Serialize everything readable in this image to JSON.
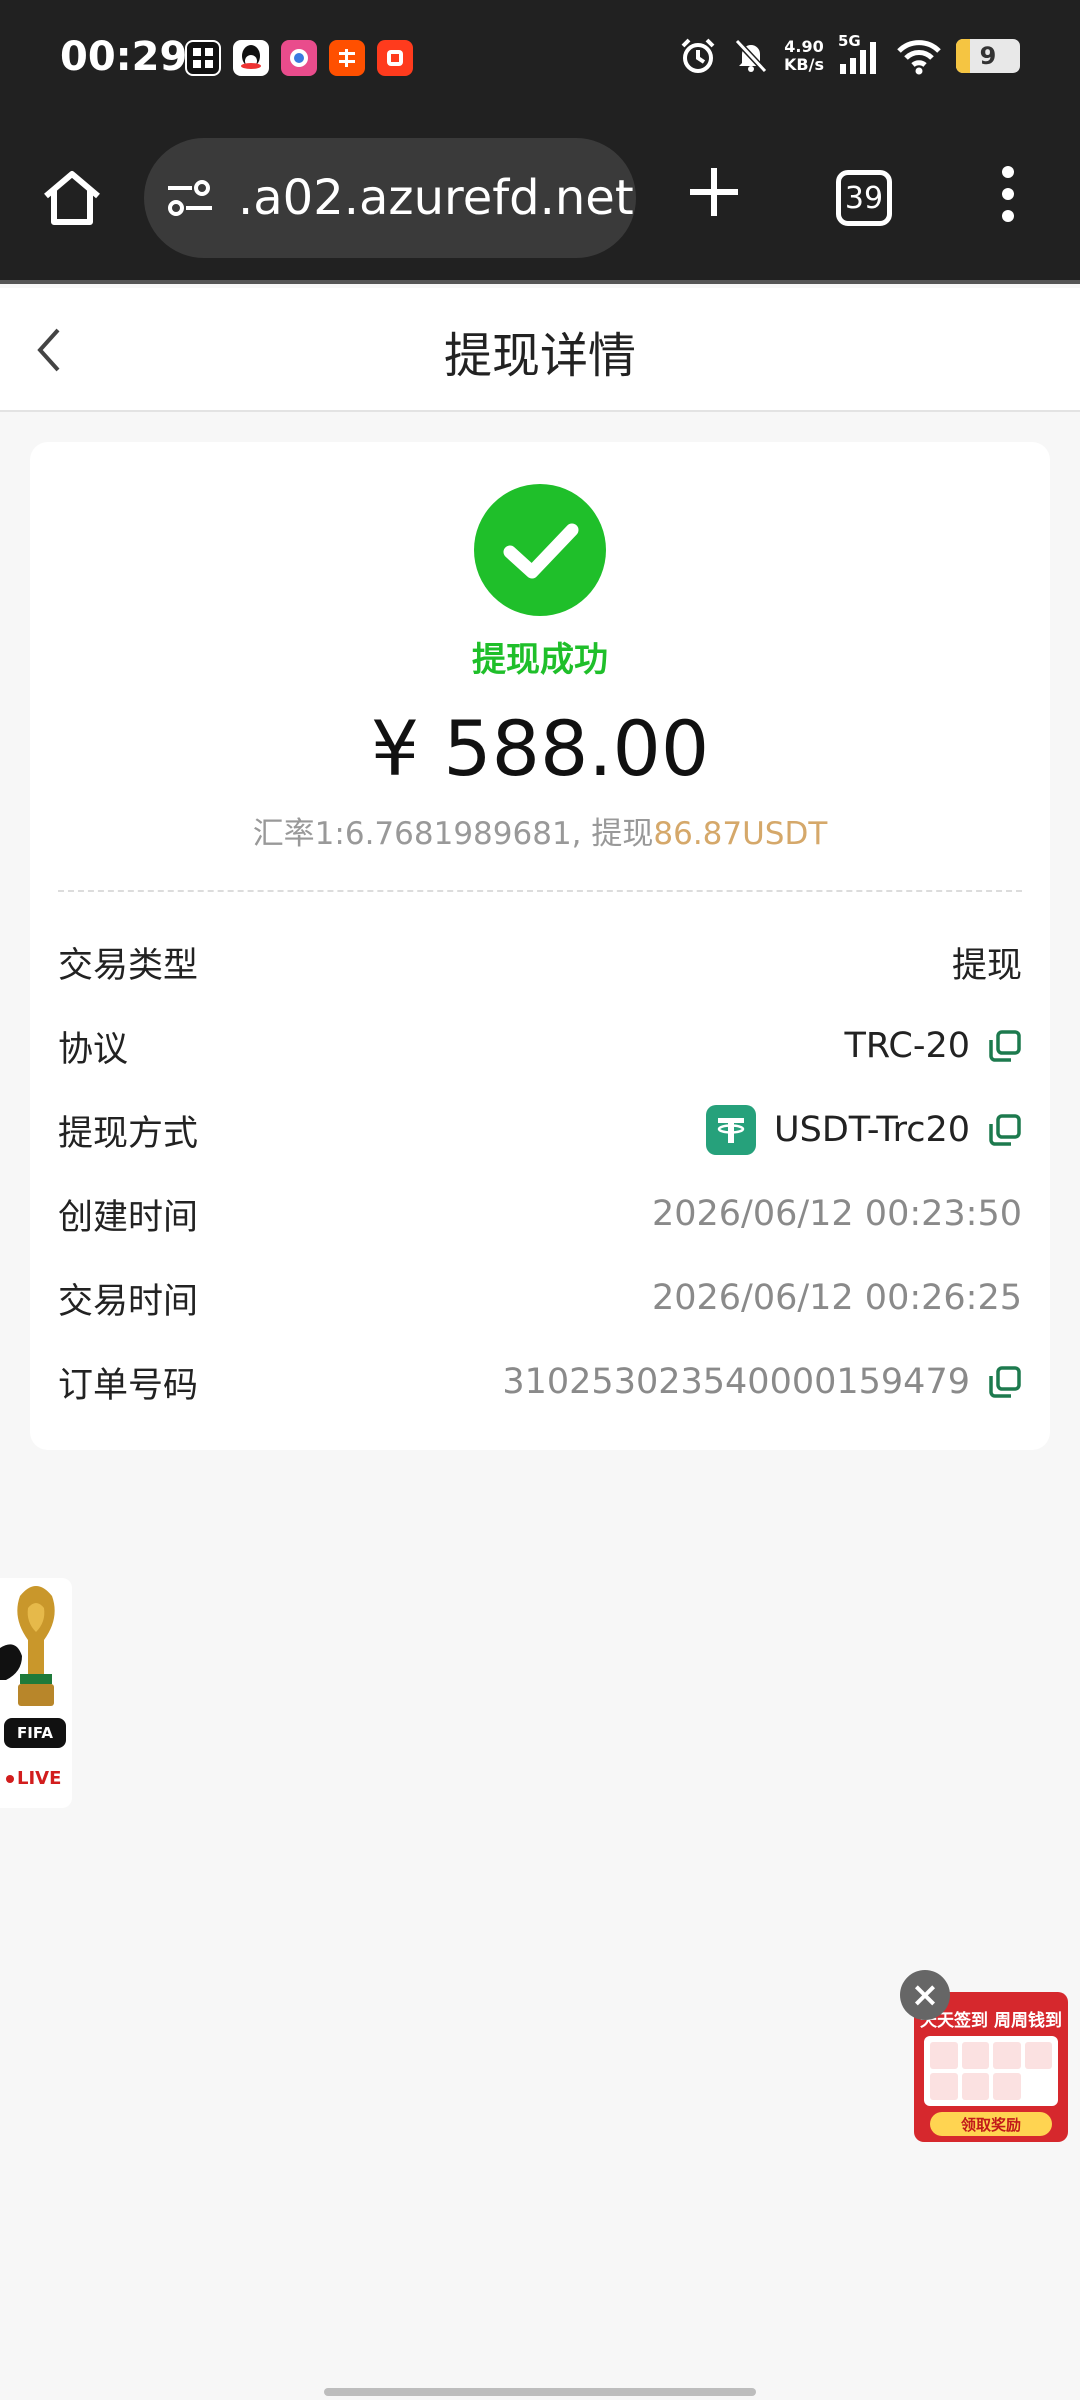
{
  "status_bar": {
    "time": "00:29",
    "net_speed_value": "4.90",
    "net_speed_unit": "KB/s",
    "signal_label": "5G",
    "battery_level": "9"
  },
  "browser": {
    "url": ".a02.azurefd.net",
    "tab_count": "39"
  },
  "header": {
    "title": "提现详情"
  },
  "summary": {
    "status": "提现成功",
    "amount": "¥ 588.00",
    "rate_prefix": "汇率1:6.7681989681, 提现",
    "rate_usdt": "86.87USDT"
  },
  "details": [
    {
      "label": "交易类型",
      "value": "提现"
    },
    {
      "label": "协议",
      "value": "TRC-20"
    },
    {
      "label": "提现方式",
      "value": "USDT-Trc20"
    },
    {
      "label": "创建时间",
      "value": "2026/06/12 00:23:50"
    },
    {
      "label": "交易时间",
      "value": "2026/06/12 00:26:25"
    },
    {
      "label": "订单号码",
      "value": "310253023540000159479"
    }
  ],
  "fifa_widget": {
    "badge": "FIFA",
    "live": "LIVE"
  },
  "promo_widget": {
    "title": "天天签到 周周钱到",
    "button": "领取奖励"
  },
  "colors": {
    "success_green": "#1fbf2a",
    "usdt_accent": "#d5a86a",
    "copy_icon_green": "#1d7a4e",
    "tether_green": "#26a17b"
  }
}
